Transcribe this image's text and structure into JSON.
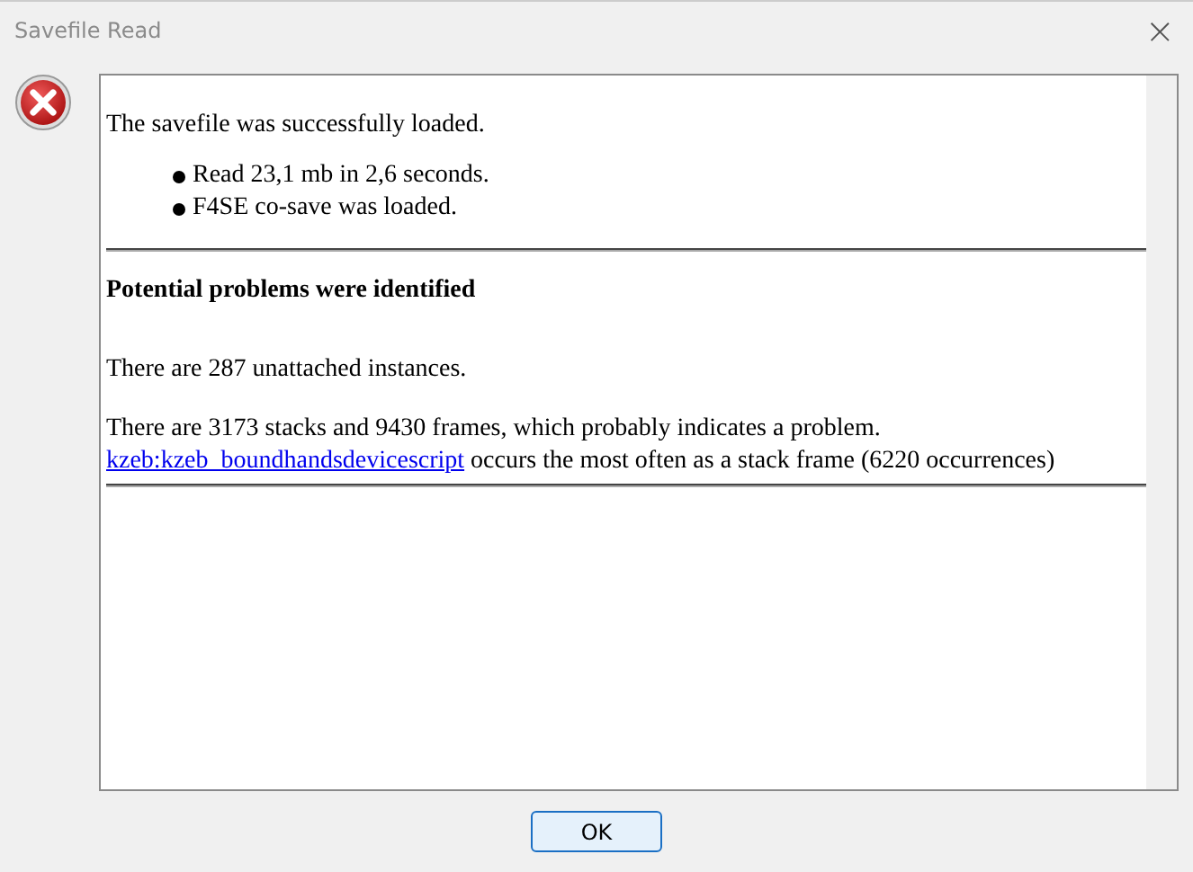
{
  "window": {
    "title": "Savefile Read",
    "close": "×"
  },
  "message": {
    "intro": "The savefile was successfully loaded.",
    "bullets": [
      "Read 23,1 mb in 2,6 seconds.",
      "F4SE co-save was loaded."
    ],
    "heading": "Potential problems were identified",
    "unattached": "There are 287 unattached instances.",
    "stacks": "There are 3173 stacks and 9430 frames, which probably indicates a problem.",
    "link": "kzeb:kzeb_boundhandsdevicescript",
    "link_rest": " occurs the most often as a stack frame (6220 occurrences)"
  },
  "buttons": [
    {
      "label": "OK"
    }
  ]
}
